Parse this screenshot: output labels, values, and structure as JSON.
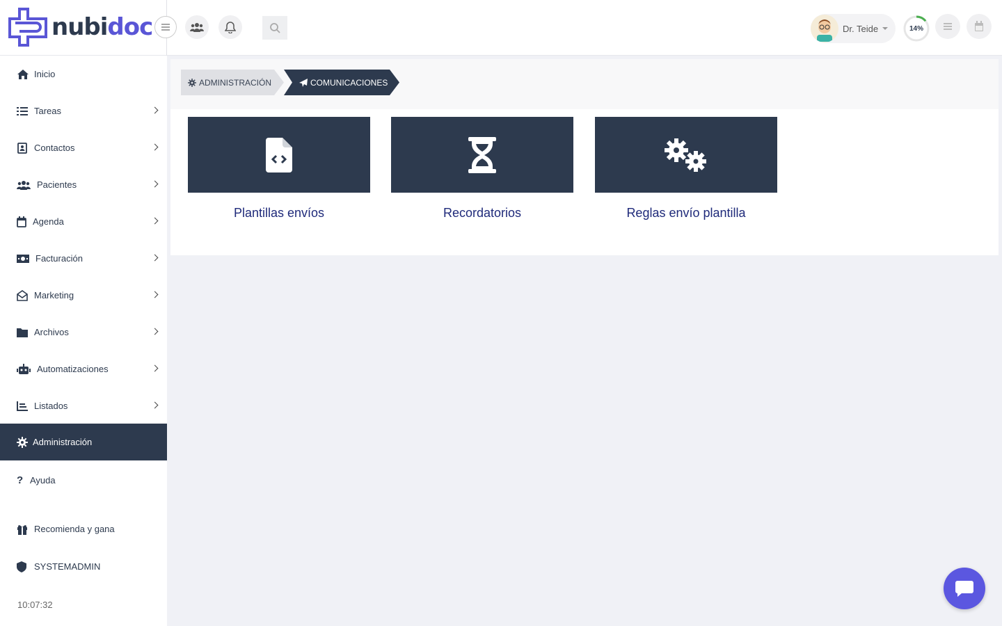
{
  "logo": {
    "part1": "nubi",
    "part2": "doc"
  },
  "header": {
    "user_name": "Dr. Teide",
    "progress_label": "14%",
    "progress_value": 0.14
  },
  "sidebar": {
    "items": [
      {
        "label": "Inicio",
        "icon": "home-icon"
      },
      {
        "label": "Tareas",
        "icon": "list-icon"
      },
      {
        "label": "Contactos",
        "icon": "address-book-icon"
      },
      {
        "label": "Pacientes",
        "icon": "users-icon"
      },
      {
        "label": "Agenda",
        "icon": "calendar-icon"
      },
      {
        "label": "Facturación",
        "icon": "money-bill-icon"
      },
      {
        "label": "Marketing",
        "icon": "envelope-open-icon"
      },
      {
        "label": "Archivos",
        "icon": "folder-icon"
      },
      {
        "label": "Automatizaciones",
        "icon": "robot-icon"
      },
      {
        "label": "Listados",
        "icon": "chart-icon"
      },
      {
        "label": "Administración",
        "icon": "gear-icon"
      },
      {
        "label": "Ayuda",
        "icon": "question-icon"
      },
      {
        "label": "Recomienda y gana",
        "icon": "gift-icon"
      },
      {
        "label": "SYSTEMADMIN",
        "icon": "shield-icon"
      }
    ],
    "clock": "10:07:32"
  },
  "breadcrumb": {
    "level1": "ADMINISTRACIÓN",
    "level2": "COMUNICACIONES"
  },
  "cards": [
    {
      "label": "Plantillas envíos",
      "icon": "file-code-icon"
    },
    {
      "label": "Recordatorios",
      "icon": "hourglass-icon"
    },
    {
      "label": "Reglas envío plantilla",
      "icon": "gears-icon"
    }
  ],
  "colors": {
    "brand_dark": "#2d3a4e",
    "brand_accent": "#5a56d6",
    "card_label": "#1f2a7a",
    "chat_button": "#5b57e0",
    "progress": "#4caf50"
  }
}
